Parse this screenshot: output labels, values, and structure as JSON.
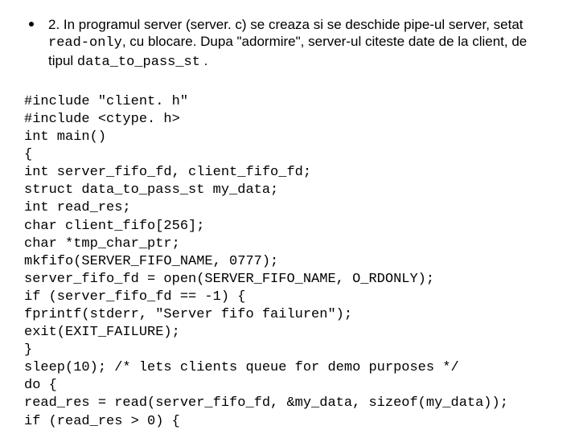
{
  "intro": {
    "part1": "2. In programul server (server. c) se creaza si se deschide pipe-ul server, setat ",
    "mono1": "read-only",
    "part2": ", cu blocare. Dupa \"adormire\", server-ul citeste date de la client, de tipul ",
    "mono2": "data_to_pass_st",
    "part3": " ."
  },
  "code": {
    "l01": "#include \"client. h\"",
    "l02": "#include <ctype. h>",
    "l03": "int main()",
    "l04": "{",
    "l05": "int server_fifo_fd, client_fifo_fd;",
    "l06": "struct data_to_pass_st my_data;",
    "l07": "int read_res;",
    "l08": "char client_fifo[256];",
    "l09": "char *tmp_char_ptr;",
    "l10": "mkfifo(SERVER_FIFO_NAME, 0777);",
    "l11": "server_fifo_fd = open(SERVER_FIFO_NAME, O_RDONLY);",
    "l12": "if (server_fifo_fd == -1) {",
    "l13": "fprintf(stderr, \"Server fifo failuren\");",
    "l14": "exit(EXIT_FAILURE);",
    "l15": "}",
    "l16": "sleep(10); /* lets clients queue for demo purposes */",
    "l17": "do {",
    "l18": "read_res = read(server_fifo_fd, &my_data, sizeof(my_data));",
    "l19": "if (read_res > 0) {"
  }
}
